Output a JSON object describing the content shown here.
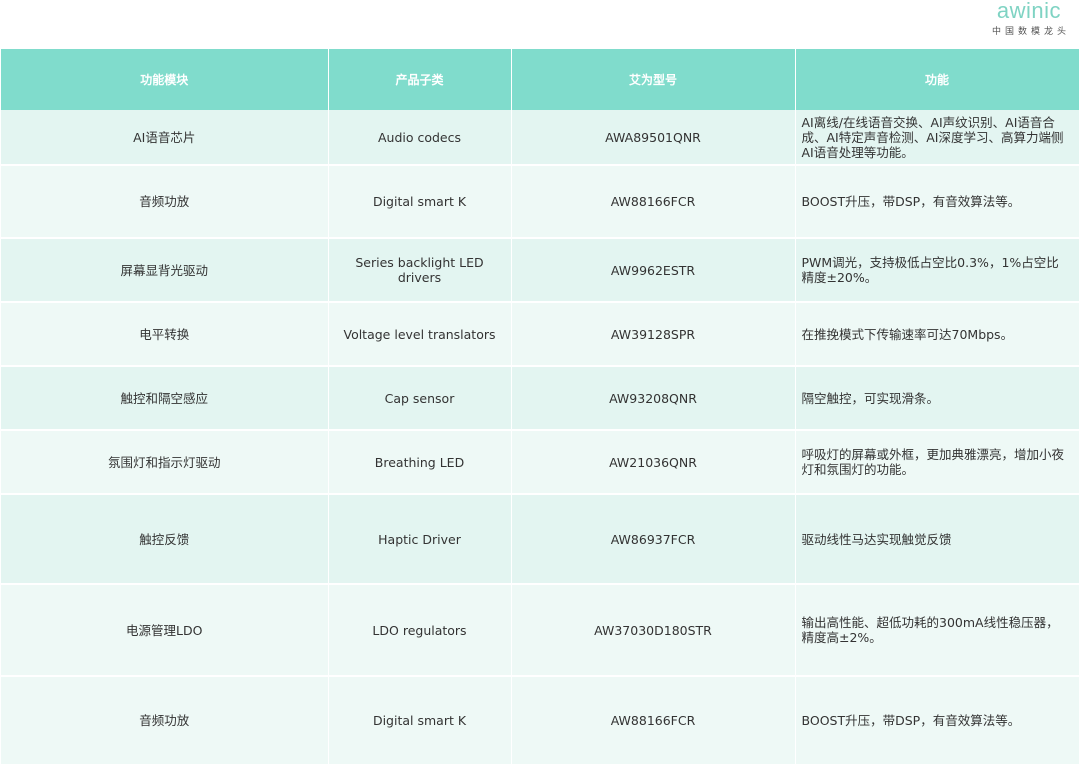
{
  "brand": {
    "name": "awinic",
    "subtitle": "中国数模龙头"
  },
  "table": {
    "headers": [
      "功能模块",
      "产品子类",
      "艾为型号",
      "功能"
    ],
    "rows": [
      {
        "module": "AI语音芯片",
        "subclass": "Audio codecs",
        "model": "AWA89501QNR",
        "function": "AI离线/在线语音交换、AI声纹识别、AI语音合成、AI特定声音检测、AI深度学习、高算力端侧AI语音处理等功能。"
      },
      {
        "module": "音频功放",
        "subclass": "Digital smart K",
        "model": "AW88166FCR",
        "function": "BOOST升压，带DSP，有音效算法等。"
      },
      {
        "module": "屏幕显背光驱动",
        "subclass": "Series backlight LED drivers",
        "model": "AW9962ESTR",
        "function": "PWM调光，支持极低占空比0.3%，1%占空比精度±20%。"
      },
      {
        "module": "电平转换",
        "subclass": "Voltage level translators",
        "model": "AW39128SPR",
        "function": "在推挽模式下传输速率可达70Mbps。"
      },
      {
        "module": "触控和隔空感应",
        "subclass": "Cap sensor",
        "model": "AW93208QNR",
        "function": "隔空触控，可实现滑条。"
      },
      {
        "module": "氛围灯和指示灯驱动",
        "subclass": "Breathing LED",
        "model": "AW21036QNR",
        "function": "呼吸灯的屏幕或外框，更加典雅漂亮，增加小夜灯和氛围灯的功能。"
      },
      {
        "module": "触控反馈",
        "subclass": "Haptic Driver",
        "model": "AW86937FCR",
        "function": "驱动线性马达实现触觉反馈"
      },
      {
        "module": "电源管理LDO",
        "subclass": "LDO regulators",
        "model": "AW37030D180STR",
        "function": "输出高性能、超低功耗的300mA线性稳压器，精度高±2%。"
      },
      {
        "module": "音频功放",
        "subclass": "Digital smart K",
        "model": "AW88166FCR",
        "function": "BOOST升压，带DSP，有音效算法等。"
      }
    ]
  }
}
